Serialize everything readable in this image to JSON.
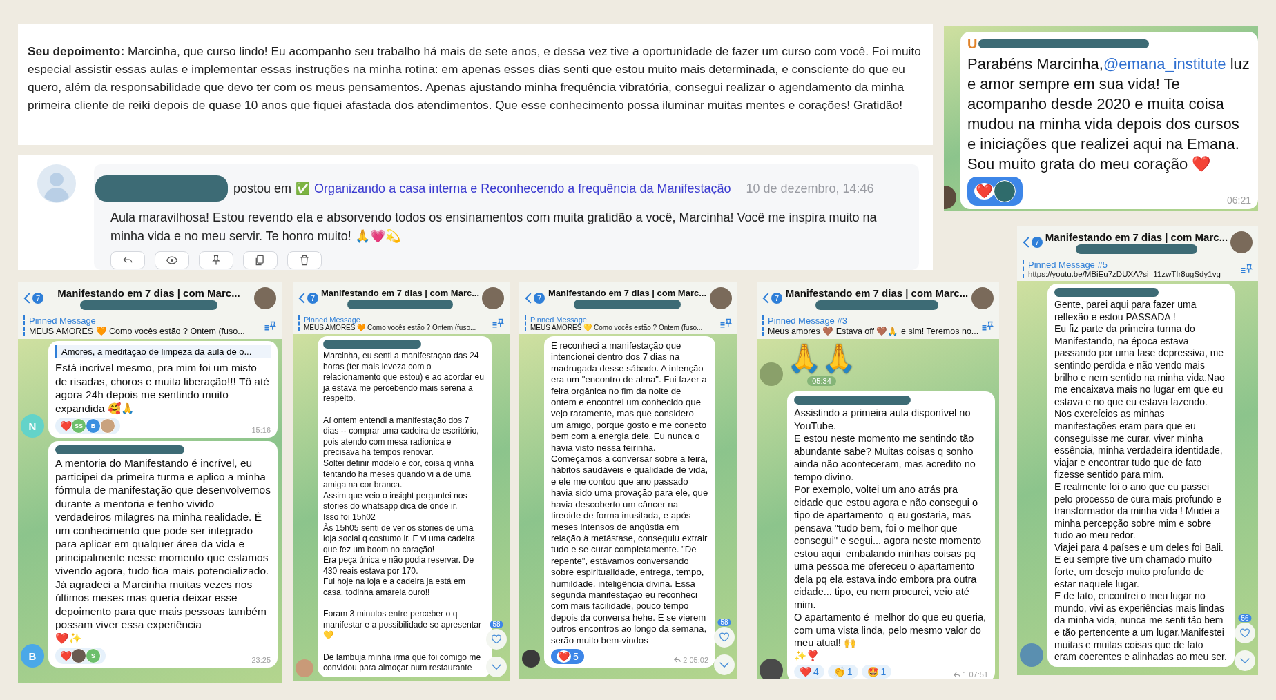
{
  "form_entry": {
    "text": "**Seu depoimento:** Marcinha, que curso lindo! Eu acompanho seu trabalho há mais de sete anos, e dessa vez tive a oportunidade de fazer um curso com você. Foi muito especial assistir essas aulas e implementar essas instruções na minha rotina: em apenas esses dias senti que estou muito mais determinada, e consciente do que eu quero, além da responsabilidade que devo ter com os meus pensamentos. Apenas ajustando minha frequência vibratória, consegui realizar o agendamento da minha primeira cliente de reiki depois de quase 10 anos que fiquei afastada dos atendimentos. Que esse conhecimento possa iluminar muitas mentes e corações! Gratidão!"
  },
  "comment": {
    "verb": "postou em",
    "check": "✅",
    "course": "Organizando a casa interna e Reconhecendo a frequência da Manifestação",
    "time": "10 de dezembro, 14:46",
    "text": "Aula maravilhosa! Estou revendo ela e absorvendo todos os ensinamentos com muita gratidão a você, Marcinha! Você me inspira muito na minha vida e no meu servir. Te honro muito! 🙏💗💫"
  },
  "chats": [
    {
      "messages": [
        {
          "sender": {
            "redacted": true,
            "initial": "U",
            "color": "#e0832a"
          },
          "text_before": "Parabéns Marcinha,",
          "mention": "@emana_institute",
          "text": " luz e amor sempre em sua vida! Te acompanho desde 2020 e muita coisa mudou na minha vida depois dos cursos e iniciações que realizei aqui na Emana. Sou muito grata do meu coração ❤️",
          "reactions": [
            {
              "emoji": "❤️",
              "selected": true,
              "avatars": [
                {
                  "kind": "photo",
                  "color": "#2f6b6b"
                }
              ]
            }
          ],
          "time": "06:21",
          "avatar": {
            "kind": "photo",
            "color": "#5b4a3c"
          }
        }
      ]
    },
    {
      "header": {
        "badge": "7",
        "title": "Manifestando em 7 dias | com Marc..."
      },
      "pinned": {
        "label": "Pinned Message",
        "text": "MEUS AMORES 🧡 Como vocês estão ? Ontem (fuso..."
      },
      "messages": [
        {
          "quote": "Amores, a meditação de limpeza da aula de o...",
          "text": "Está incrível mesmo, pra mim foi um misto de risadas, choros e muita liberação!!! Tô até agora 24h depois me sentindo muito expandida 🥰🙏",
          "reactions": [
            {
              "emoji": "❤️",
              "selected": false,
              "avatars": [
                {
                  "kind": "letter",
                  "text": "SS",
                  "color": "#6cbf6c"
                },
                {
                  "kind": "letter",
                  "text": "B",
                  "color": "#3a8fe0"
                },
                {
                  "kind": "photo",
                  "color": "#c9a27e"
                }
              ]
            }
          ],
          "time": "15:16",
          "avatar": {
            "kind": "letter",
            "text": "N",
            "color": "#63d3c9"
          }
        },
        {
          "sender": {
            "redacted": true
          },
          "text": "A mentoria do Manifestando é incrível, eu participei da primeira turma e aplico a minha fórmula de manifestação que desenvolvemos durante a mentoria e tenho vivido verdadeiros milagres na minha realidade. É um conhecimento que pode ser integrado para aplicar em qualquer área da vida e principalmente nesse momento que estamos vivendo agora, tudo fica mais potencializado. Já agradeci a Marcinha muitas vezes nos últimos meses mas queria deixar esse depoimento para que mais pessoas também possam viver essa experiência\n❤️✨",
          "reactions": [
            {
              "emoji": "❤️",
              "selected": false,
              "avatars": [
                {
                  "kind": "photo",
                  "color": "#6a5a50"
                },
                {
                  "kind": "letter",
                  "text": "S",
                  "color": "#6cbf6c"
                }
              ]
            }
          ],
          "time": "23:25",
          "avatar": {
            "kind": "letter",
            "text": "B",
            "color": "#4aa8e8"
          }
        }
      ]
    },
    {
      "header": {
        "badge": "7",
        "title": "Manifestando em 7 dias | com Marc..."
      },
      "pinned": {
        "label": "Pinned Message",
        "text": "MEUS AMORES 🧡 Como vocês estão ? Ontem (fuso..."
      },
      "scroll": {
        "count": "58"
      },
      "messages": [
        {
          "sender": {
            "redacted": true
          },
          "text": "Marcinha, eu senti a manifestaçao das 24 horas (ter mais leveza com o relacionamento que estou) e ao acordar eu ja estava me percebendo mais serena a respeito.\n\nAí ontem entendi a manifestação dos 7 dias -- comprar uma cadeira de escritório, pois atendo com mesa radionica e precisava ha tempos renovar.\nSoltei definir modelo e cor, coisa q vinha tentando ha meses quando vi a de uma amiga na cor branca.\nAssim que veio o insight perguntei nos stories do whatsapp dica de onde ir.\nIsso foi 15h02\nÀs 15h05 senti de ver os stories de uma loja social q costumo ir. E vi uma cadeira que fez um boom no coração!\nEra peça única e não podia reservar. De 430 reais estava por 170.\nFui hoje na loja e a cadeira ja está em casa, todinha amarela ouro!!\n\nForam 3 minutos entre perceber o q manifestar e a possibilidade se apresentar\n💛\n\nDe lambuja minha irmã que foi comigo me convidou para almoçar num restaurante",
          "avatar": {
            "kind": "photo",
            "color": "#c99a78"
          }
        }
      ]
    },
    {
      "header": {
        "badge": "7",
        "title": "Manifestando em 7 dias | com Marc..."
      },
      "pinned": {
        "label": "Pinned Message",
        "text": "MEUS AMORES 💛 Como vocês estão ? Ontem (fuso..."
      },
      "scroll": {
        "count": "58"
      },
      "messages": [
        {
          "text": "E reconheci a manifestação que intencionei dentro dos 7 dias na madrugada desse sábado. A intenção era um \"encontro de alma\". Fui fazer a feira orgânica no fim da noite de ontem e encontrei um conhecido que vejo raramente, mas que considero um amigo, porque gosto e me conecto bem com a energia dele. Eu nunca o havia visto nessa feirinha. Começamos a conversar sobre a feira, hábitos saudáveis e qualidade de vida, e ele me contou que ano passado havia sido uma provação para ele, que havia descoberto um câncer na tireoide de forma inusitada, e após meses intensos de angústia em relação à metástase, conseguiu extrair tudo e se curar completamente. \"De repente\", estávamos conversando sobre espiritualidade, entrega, tempo, humildade, inteligência divina. Essa segunda manifestação eu reconheci com mais facilidade, pouco tempo depois da conversa hehe. E se vierem outros encontros ao longo da semana, serão muito bem-vindos",
          "reactions": [
            {
              "emoji": "❤️",
              "count": "5",
              "selected": true
            }
          ],
          "forwards": "2",
          "time": "05:02",
          "avatar": {
            "kind": "photo",
            "color": "#3a3a3a"
          }
        }
      ]
    },
    {
      "header": {
        "badge": "7",
        "title": "Manifestando em 7 dias | com Marc..."
      },
      "pinned": {
        "label": "Pinned Message #3",
        "text": "Meus amores 🤎 Estava off 🤎🙏 e sim! Teremos no..."
      },
      "messages": [
        {
          "kind": "sticker",
          "text": "🙏🙏",
          "time": "05:34",
          "avatar": {
            "kind": "photo",
            "color": "#8aa06a"
          }
        },
        {
          "sender": {
            "redacted": true
          },
          "text": "Assistindo a primeira aula disponível no YouTube.\nE estou neste momento me sentindo tão abundante sabe? Muitas coisas q sonho ainda não aconteceram, mas acredito no tempo divino.\nPor exemplo, voltei um ano atrás pra cidade que estou agora e não consegui o tipo de apartamento  q eu gostaria, mas pensava \"tudo bem, foi o melhor que consegui\" e segui... agora neste momento estou aqui  embalando minhas coisas pq uma pessoa me ofereceu o apartamento dela pq ela estava indo embora pra outra cidade... tipo, eu nem procurei, veio até  mim.\nO apartamento é  melhor do que eu queria, com uma vista linda, pelo mesmo valor do meu atual! 🙌\n✨❣️",
          "reactions": [
            {
              "emoji": "❤️",
              "count": "4",
              "selected": false
            },
            {
              "emoji": "👏",
              "count": "1",
              "selected": false
            },
            {
              "emoji": "🤩",
              "count": "1",
              "selected": false
            }
          ],
          "forwards": "1",
          "time": "07:51",
          "avatar": {
            "kind": "photo",
            "color": "#4a4a4a"
          }
        }
      ]
    },
    {
      "header": {
        "badge": "7",
        "title": "Manifestando em 7 dias | com Marc..."
      },
      "pinned": {
        "label": "Pinned Message #5",
        "text": "https://youtu.be/MBiEu7zDUXA?si=11zwTIr8ugSdy1vg"
      },
      "scroll": {
        "count": "56"
      },
      "messages": [
        {
          "sender": {
            "redacted": true
          },
          "text": "Gente, parei aqui para fazer uma reflexão e estou PASSADA !\nEu fiz parte da primeira turma do Manifestando, na época estava passando por uma fase depressiva, me sentindo perdida e não vendo mais brilho e nem sentido na minha vida.Nao me encaixava mais no lugar em que eu estava e no que eu estava fazendo.\nNos exercícios as minhas manifestações eram para que eu conseguisse me curar, viver minha essência, minha verdadeira identidade, viajar e encontrar tudo que de fato fizesse sentido para mim.\nE realmente foi o ano que eu passei pelo processo de cura mais profundo e transformador da minha vida ! Mudei a minha percepção sobre mim e sobre tudo ao meu redor.\nViajei para 4 países e um deles foi Bali.\nE eu sempre tive um chamado muito forte, um desejo muito profundo de estar naquele lugar.\nE de fato, encontrei o meu lugar no mundo, vivi as experiências mais lindas da minha vida, nunca me senti tão bem e tão pertencente a um lugar.Manifestei muitas e muitas coisas que de fato eram coerentes e alinhadas ao meu ser.",
          "avatar": {
            "kind": "photo",
            "color": "#5a8fb0"
          }
        }
      ]
    }
  ]
}
